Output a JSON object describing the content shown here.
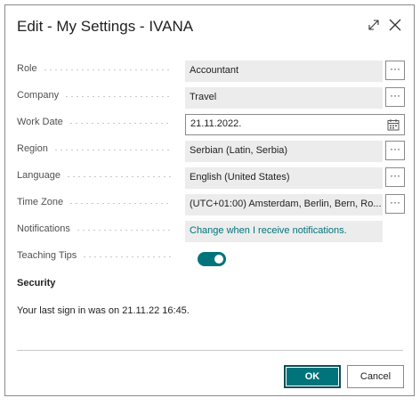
{
  "dialog": {
    "title": "Edit - My Settings - IVANA",
    "expand_icon": "expand-icon",
    "close_icon": "close-icon"
  },
  "fields": {
    "role": {
      "label": "Role",
      "value": "Accountant"
    },
    "company": {
      "label": "Company",
      "value": "Travel"
    },
    "work_date": {
      "label": "Work Date",
      "value": "21.11.2022."
    },
    "region": {
      "label": "Region",
      "value": "Serbian (Latin, Serbia)"
    },
    "language": {
      "label": "Language",
      "value": "English (United States)"
    },
    "time_zone": {
      "label": "Time Zone",
      "value": "(UTC+01:00) Amsterdam, Berlin, Bern, Ro..."
    },
    "notifications": {
      "label": "Notifications",
      "link": "Change when I receive notifications."
    },
    "teaching_tips": {
      "label": "Teaching Tips",
      "on": true
    }
  },
  "more_button_label": "···",
  "security": {
    "heading": "Security",
    "last_sign_in": "Your last sign in was on 21.11.22 16:45."
  },
  "buttons": {
    "ok": "OK",
    "cancel": "Cancel"
  },
  "colors": {
    "accent": "#00737b",
    "field_bg": "#ececec"
  }
}
